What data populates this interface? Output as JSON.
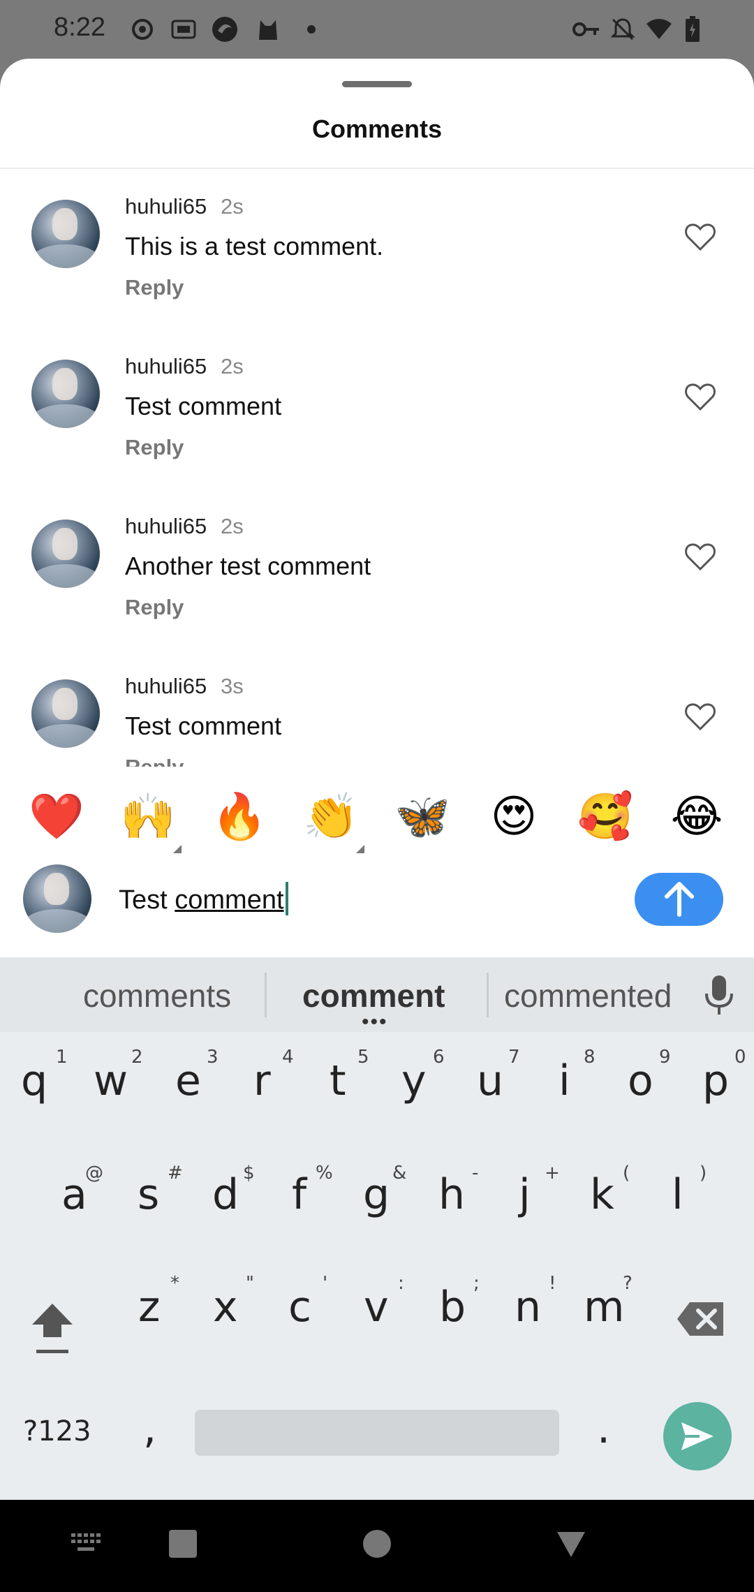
{
  "status_bar": {
    "time": "8:22",
    "left_icons": [
      "record-icon",
      "iqiyi-icon",
      "app-icon",
      "cat-icon",
      "dot-icon"
    ],
    "right_icons": [
      "vpn-key-icon",
      "notifications-off-icon",
      "wifi-icon",
      "battery-icon"
    ]
  },
  "sheet": {
    "title": "Comments"
  },
  "comments": [
    {
      "user": "huhuli65",
      "time": "2s",
      "text": "This is a test comment.",
      "reply": "Reply"
    },
    {
      "user": "huhuli65",
      "time": "2s",
      "text": "Test comment",
      "reply": "Reply"
    },
    {
      "user": "huhuli65",
      "time": "2s",
      "text": "Another test comment",
      "reply": "Reply"
    },
    {
      "user": "huhuli65",
      "time": "3s",
      "text": "Test comment",
      "reply": "Reply"
    }
  ],
  "emoji_bar": [
    "❤️",
    "🙌",
    "🔥",
    "👏",
    "🦋",
    "😍",
    "🥰",
    "😂"
  ],
  "input": {
    "prefix": "Test ",
    "underlined": "comment"
  },
  "keyboard": {
    "suggestions": [
      "comments",
      "comment",
      "commented"
    ],
    "row1": [
      "q",
      "w",
      "e",
      "r",
      "t",
      "y",
      "u",
      "i",
      "o",
      "p"
    ],
    "row1_hints": [
      "1",
      "2",
      "3",
      "4",
      "5",
      "6",
      "7",
      "8",
      "9",
      "0"
    ],
    "row2": [
      "a",
      "s",
      "d",
      "f",
      "g",
      "h",
      "j",
      "k",
      "l"
    ],
    "row2_hints": [
      "@",
      "#",
      "$",
      "%",
      "&",
      "-",
      "+",
      "(",
      ")"
    ],
    "row3": [
      "z",
      "x",
      "c",
      "v",
      "b",
      "n",
      "m"
    ],
    "row3_hints": [
      "*",
      "\"",
      "'",
      ":",
      ";",
      "!",
      "?"
    ],
    "symbols_key": "?123",
    "comma_key": ",",
    "period_key": "."
  },
  "colors": {
    "send_button": "#3b8ff0",
    "enter_key": "#5bb3a0",
    "keyboard_bg": "#e9edf0"
  }
}
